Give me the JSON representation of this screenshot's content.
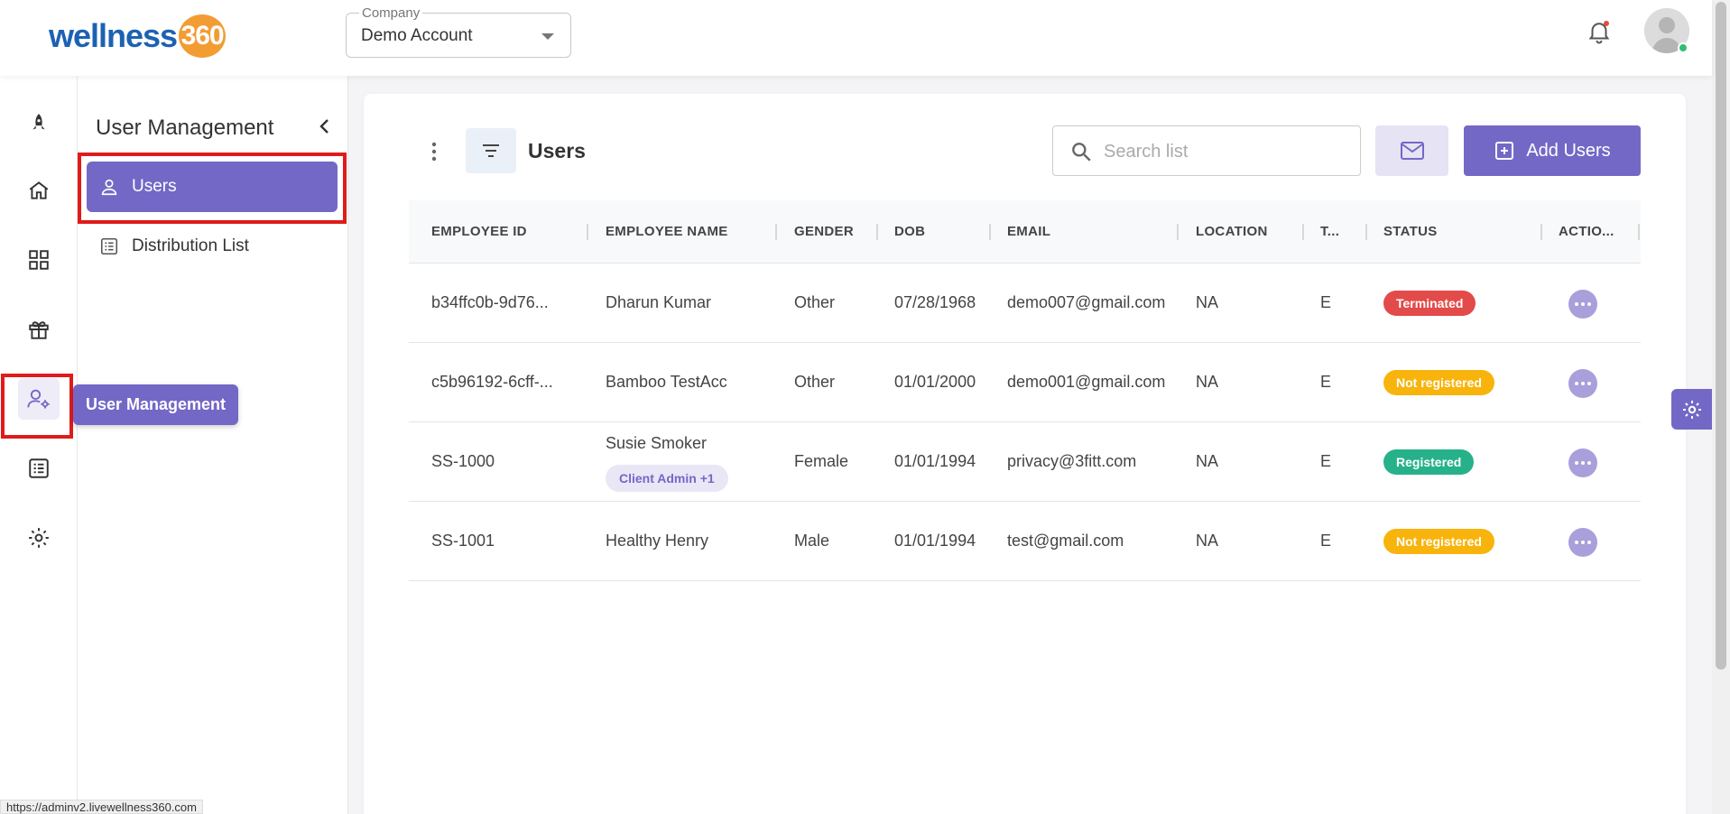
{
  "header": {
    "logo_text": "wellness",
    "logo_number": "360",
    "company_label": "Company",
    "company_value": "Demo Account"
  },
  "tooltip": "User Management",
  "subnav": {
    "title": "User Management",
    "items": [
      {
        "label": "Users"
      },
      {
        "label": "Distribution List"
      }
    ]
  },
  "list": {
    "title": "Users",
    "search_placeholder": "Search list",
    "add_label": "Add Users"
  },
  "table": {
    "headers": [
      "EMPLOYEE ID",
      "EMPLOYEE NAME",
      "GENDER",
      "DOB",
      "EMAIL",
      "LOCATION",
      "T...",
      "STATUS",
      "ACTIO..."
    ],
    "rows": [
      {
        "id": "b34ffc0b-9d76...",
        "name": "Dharun Kumar",
        "gender": "Other",
        "dob": "07/28/1968",
        "email": "demo007@gmail.com",
        "location": "NA",
        "t": "E",
        "status": "Terminated",
        "role": ""
      },
      {
        "id": "c5b96192-6cff-...",
        "name": "Bamboo TestAcc",
        "gender": "Other",
        "dob": "01/01/2000",
        "email": "demo001@gmail.com",
        "location": "NA",
        "t": "E",
        "status": "Not registered",
        "role": ""
      },
      {
        "id": "SS-1000",
        "name": "Susie Smoker",
        "gender": "Female",
        "dob": "01/01/1994",
        "email": "privacy@3fitt.com",
        "location": "NA",
        "t": "E",
        "status": "Registered",
        "role": "Client Admin +1"
      },
      {
        "id": "SS-1001",
        "name": "Healthy Henry",
        "gender": "Male",
        "dob": "01/01/1994",
        "email": "test@gmail.com",
        "location": "NA",
        "t": "E",
        "status": "Not registered",
        "role": ""
      }
    ]
  },
  "status_url": "https://adminv2.livewellness360.com",
  "colors": {
    "accent": "#7468c6",
    "terminated": "#e34a4a",
    "not_registered": "#f8b40c",
    "registered": "#27b18a",
    "highlight": "#e01b1b"
  }
}
